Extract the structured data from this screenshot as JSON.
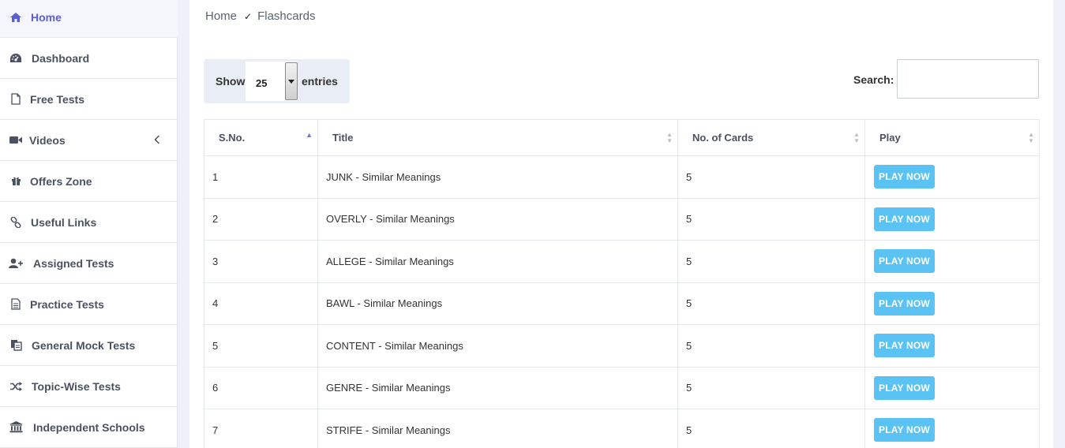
{
  "sidebar": {
    "items": [
      {
        "label": "Home",
        "icon": "home-icon",
        "active": true
      },
      {
        "label": "Dashboard",
        "icon": "dashboard-icon"
      },
      {
        "label": "Free Tests",
        "icon": "file-icon"
      },
      {
        "label": "Videos",
        "icon": "video-camera-icon",
        "chevron": "chevron-left-icon"
      },
      {
        "label": "Offers Zone",
        "icon": "gift-icon"
      },
      {
        "label": "Useful Links",
        "icon": "link-icon"
      },
      {
        "label": "Assigned Tests",
        "icon": "user-plus-icon"
      },
      {
        "label": "Practice Tests",
        "icon": "file-text-icon"
      },
      {
        "label": "General Mock Tests",
        "icon": "copy-icon"
      },
      {
        "label": "Topic-Wise Tests",
        "icon": "shuffle-icon"
      },
      {
        "label": "Independent Schools",
        "icon": "bank-icon"
      }
    ]
  },
  "breadcrumb": {
    "home": "Home",
    "separator": "✓",
    "current": "Flashcards"
  },
  "length_menu": {
    "show_label": "Show",
    "value": "25",
    "entries_label": "entries"
  },
  "search": {
    "label": "Search:",
    "value": "",
    "placeholder": ""
  },
  "table": {
    "headers": [
      "S.No.",
      "Title",
      "No. of Cards",
      "Play"
    ],
    "rows": [
      {
        "sno": "1",
        "title": "JUNK - Similar Meanings",
        "cards": "5",
        "play": "PLAY NOW"
      },
      {
        "sno": "2",
        "title": "OVERLY - Similar Meanings",
        "cards": "5",
        "play": "PLAY NOW"
      },
      {
        "sno": "3",
        "title": "ALLEGE - Similar Meanings",
        "cards": "5",
        "play": "PLAY NOW"
      },
      {
        "sno": "4",
        "title": "BAWL - Similar Meanings",
        "cards": "5",
        "play": "PLAY NOW"
      },
      {
        "sno": "5",
        "title": "CONTENT - Similar Meanings",
        "cards": "5",
        "play": "PLAY NOW"
      },
      {
        "sno": "6",
        "title": "GENRE - Similar Meanings",
        "cards": "5",
        "play": "PLAY NOW"
      },
      {
        "sno": "7",
        "title": "STRIFE - Similar Meanings",
        "cards": "5",
        "play": "PLAY NOW"
      }
    ]
  },
  "colors": {
    "accent": "#5b5fd6",
    "play_button": "#5bc3f3",
    "page_bg": "#eef1f7"
  }
}
